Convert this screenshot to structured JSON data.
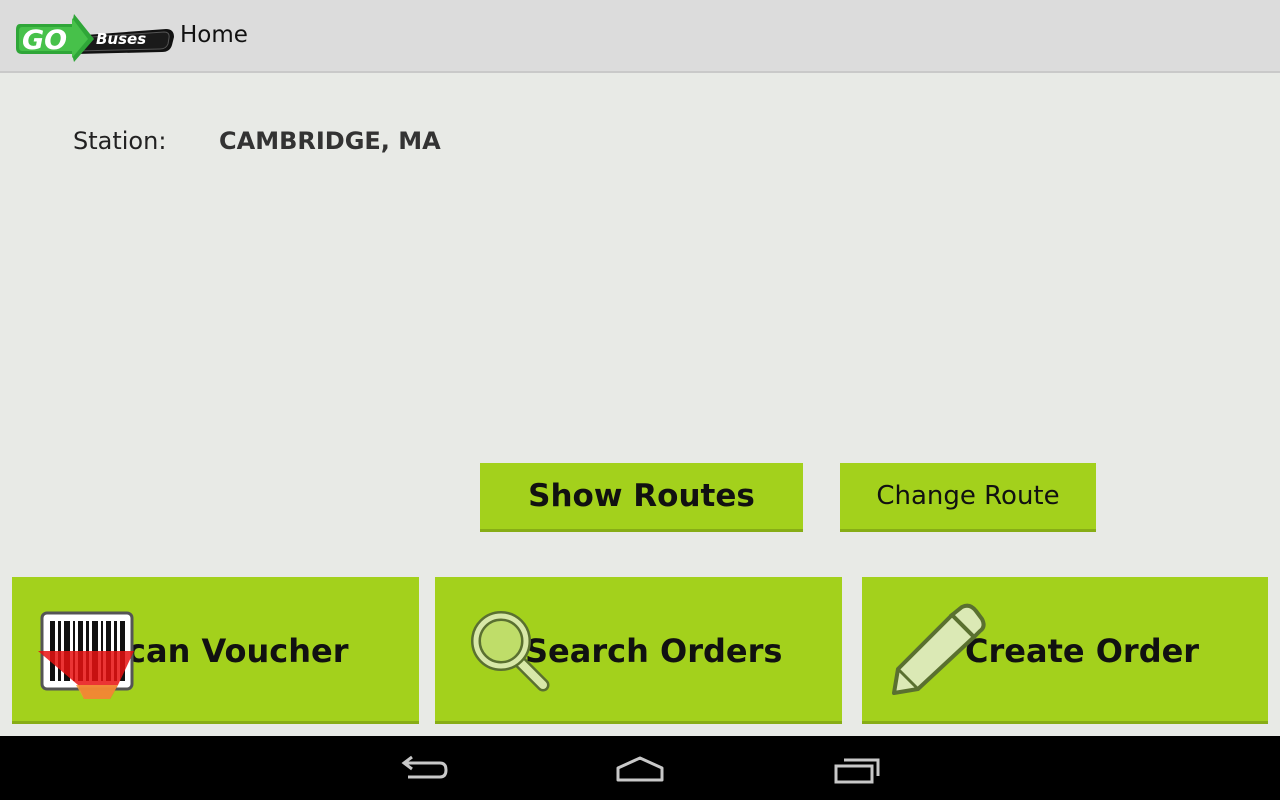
{
  "actionbar": {
    "logo_go": "GO",
    "logo_buses": "Buses",
    "title": "Home"
  },
  "station": {
    "label": "Station:",
    "value": "CAMBRIDGE, MA"
  },
  "buttons": {
    "show_routes": "Show Routes",
    "change_route": "Change Route"
  },
  "actions": {
    "scan_voucher": "can Voucher",
    "search_orders": "Search Orders",
    "create_order": "Create Order"
  },
  "colors": {
    "accent": "#a3d11c",
    "actionbar": "#dcdcdc",
    "background": "#e8eae6",
    "navbar": "#000000"
  },
  "icons": [
    "barcode-scan-icon",
    "magnifier-icon",
    "pencil-icon",
    "back-icon",
    "home-icon",
    "recent-apps-icon"
  ]
}
